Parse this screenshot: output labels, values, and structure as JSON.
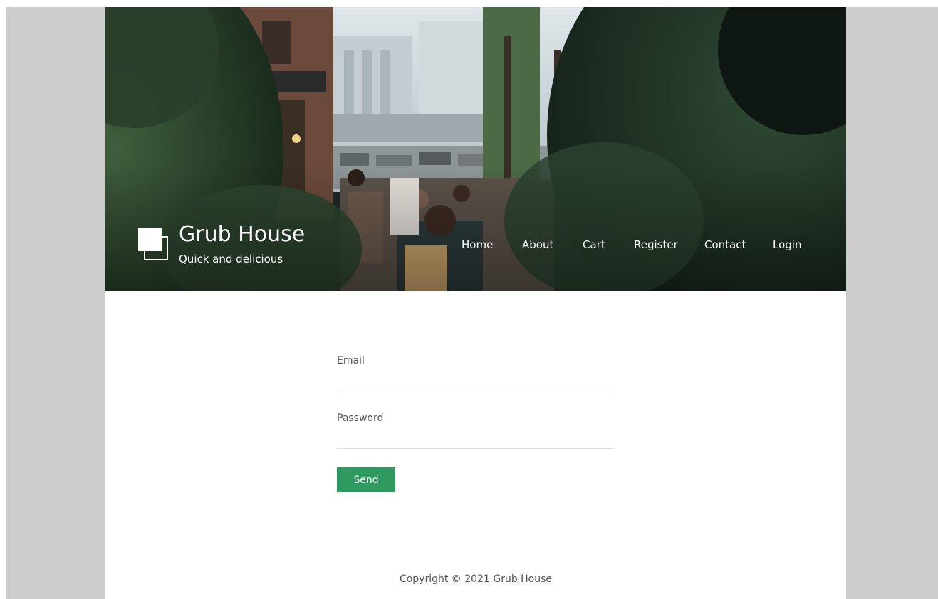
{
  "site": {
    "title": "Grub House",
    "tagline": "Quick and delicious"
  },
  "nav": {
    "items": [
      {
        "label": "Home"
      },
      {
        "label": "About"
      },
      {
        "label": "Cart"
      },
      {
        "label": "Register"
      },
      {
        "label": "Contact"
      },
      {
        "label": "Login"
      }
    ]
  },
  "form": {
    "email_label": "Email",
    "email_value": "",
    "password_label": "Password",
    "password_value": "",
    "send_label": "Send"
  },
  "footer": {
    "copyright": "Copyright © 2021 Grub House"
  },
  "colors": {
    "page_background": "#cccccc",
    "button": "#2e9a5f",
    "text_muted": "#555555"
  },
  "icons": {
    "logo": "overlapping-squares-icon"
  }
}
